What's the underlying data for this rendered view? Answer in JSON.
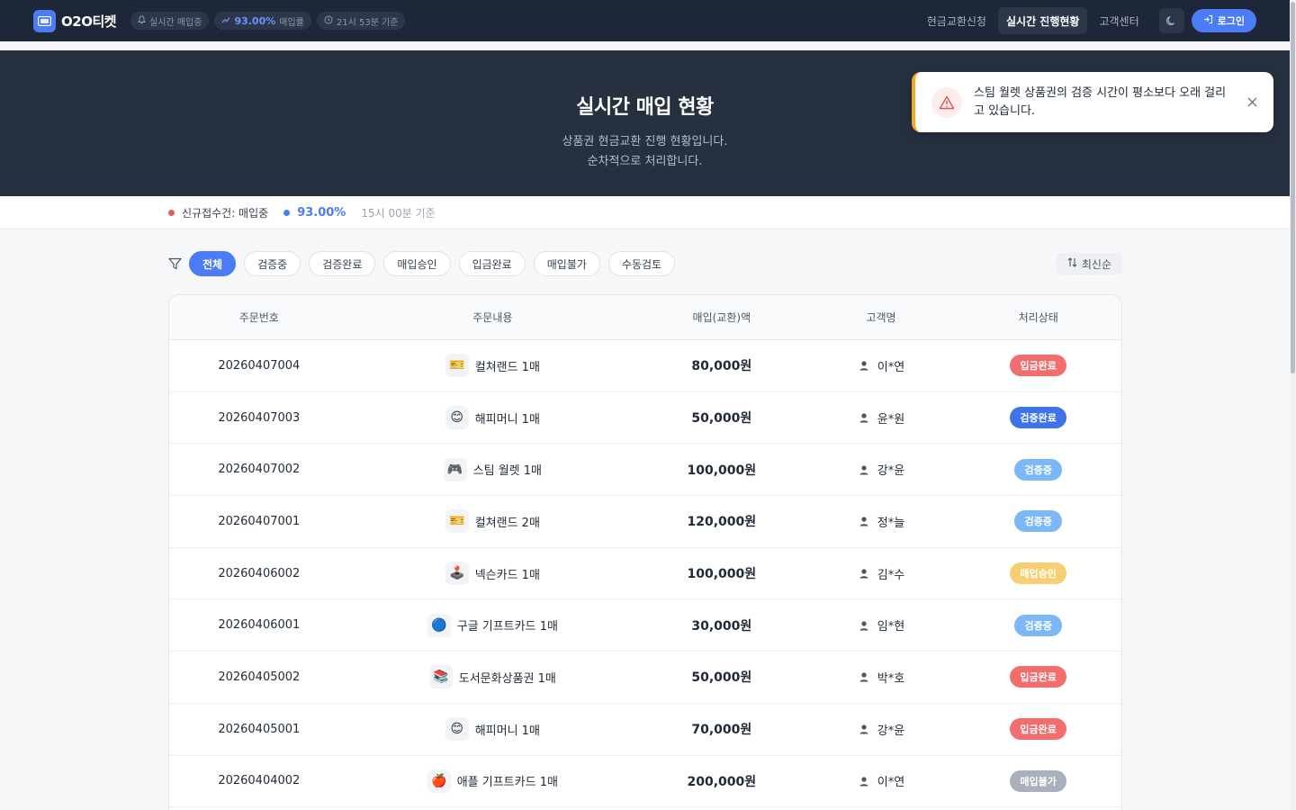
{
  "header": {
    "logo_text": "O2O티켓",
    "status_pill": "실시간 매입중",
    "rate_value": "93.00%",
    "rate_label": "매입률",
    "time_pill": "21시 53분 기준",
    "nav": [
      {
        "label": "현금교환신청",
        "active": false
      },
      {
        "label": "실시간 진행현황",
        "active": true
      },
      {
        "label": "고객센터",
        "active": false
      }
    ],
    "login_label": "로그인"
  },
  "hero": {
    "title": "실시간 매입 현황",
    "subtitle_line1": "상품권 현금교환 진행 현황입니다.",
    "subtitle_line2": "순차적으로 처리합니다."
  },
  "strip": {
    "new_label": "신규접수건: 매입중",
    "new_color": "#e25b5b",
    "rate": "93.00%",
    "rate_color": "#4b7bf5",
    "time": "15시 00분 기준"
  },
  "filters": {
    "chips": [
      "전체",
      "검증중",
      "검증완료",
      "매입승인",
      "입금완료",
      "매입불가",
      "수동검토"
    ],
    "active_index": 0,
    "sort_label": "최신순"
  },
  "table": {
    "headers": [
      "주문번호",
      "주문내용",
      "매입(교환)액",
      "고객명",
      "처리상태"
    ],
    "rows": [
      {
        "order": "20260407004",
        "icon": "🎫",
        "product": "컬쳐랜드 1매",
        "amount": "80,000원",
        "customer": "이*연",
        "status": "입금완료"
      },
      {
        "order": "20260407003",
        "icon": "😊",
        "product": "해피머니 1매",
        "amount": "50,000원",
        "customer": "윤*원",
        "status": "검증완료"
      },
      {
        "order": "20260407002",
        "icon": "🎮",
        "product": "스팀 월렛 1매",
        "amount": "100,000원",
        "customer": "강*윤",
        "status": "검증중"
      },
      {
        "order": "20260407001",
        "icon": "🎫",
        "product": "컬쳐랜드 2매",
        "amount": "120,000원",
        "customer": "정*늘",
        "status": "검증중"
      },
      {
        "order": "20260406002",
        "icon": "🕹️",
        "product": "넥슨카드 1매",
        "amount": "100,000원",
        "customer": "김*수",
        "status": "매입승인"
      },
      {
        "order": "20260406001",
        "icon": "🔵",
        "product": "구글 기프트카드 1매",
        "amount": "30,000원",
        "customer": "임*현",
        "status": "검증중"
      },
      {
        "order": "20260405002",
        "icon": "📚",
        "product": "도서문화상품권 1매",
        "amount": "50,000원",
        "customer": "박*호",
        "status": "입금완료"
      },
      {
        "order": "20260405001",
        "icon": "😊",
        "product": "해피머니 1매",
        "amount": "70,000원",
        "customer": "강*윤",
        "status": "입금완료"
      },
      {
        "order": "20260404002",
        "icon": "🍎",
        "product": "애플 기프트카드 1매",
        "amount": "200,000원",
        "customer": "이*연",
        "status": "매입불가"
      }
    ]
  },
  "status_colors": {
    "입금완료": "#f26d6d",
    "검증완료": "#3f74e8",
    "검증중": "#7cb8f7",
    "매입승인": "#f6cf72",
    "매입불가": "#a8b0bd"
  },
  "toast": {
    "message": "스팀 월렛 상품권의 검증 시간이 평소보다 오래 걸리고 있습니다.",
    "icon": "warning-icon",
    "accent": "#f5a623"
  }
}
